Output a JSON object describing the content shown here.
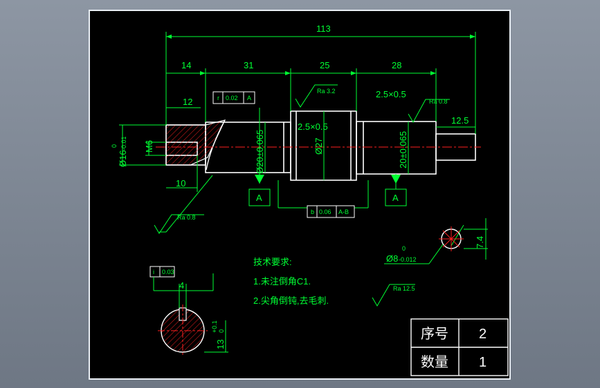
{
  "dimensions": {
    "overall_length": "113",
    "seg_14": "14",
    "seg_31": "31",
    "seg_25": "25",
    "seg_28": "28",
    "thread_len": "12",
    "end_len": "12.5",
    "hole_depth": "10",
    "dia_16": "Ø16",
    "dia_16_upper": "0",
    "dia_16_lower": "-0.01",
    "thread_m6": "M6",
    "dia_20_left": "Ø20±0.065",
    "dia_27": "Ø27",
    "dia_20_right": "20±0.065",
    "chamfer_left": "2.5×0.5",
    "chamfer_right": "2.5×0.5",
    "dia_8": "Ø8",
    "dia_8_upper": "0",
    "dia_8_lower": "-0.012",
    "key_depth": "7.4",
    "section_width": "4",
    "section_depth": "13",
    "section_depth_upper": "+0.1",
    "section_depth_lower": "0"
  },
  "roughness": {
    "ra_32": "Ra 3.2",
    "ra_08_right": "Ra 0.8",
    "ra_08_left": "Ra 0.8",
    "ra_125": "Ra 12.5"
  },
  "tolerance_frames": {
    "runout_top": {
      "symbol": "r",
      "value": "0.02",
      "datum": "A"
    },
    "runout_bottom": {
      "symbol": "b",
      "value": "0.06",
      "datum": "A-B"
    },
    "symmetry": {
      "symbol": "i",
      "value": "0.03"
    }
  },
  "datums": {
    "left": "A",
    "right": "A"
  },
  "notes": {
    "title": "技术要求:",
    "line1": "1.未注倒角C1.",
    "line2": "2.尖角倒钝,去毛刺."
  },
  "title_block": {
    "serial_label": "序号",
    "serial_value": "2",
    "qty_label": "数量",
    "qty_value": "1"
  },
  "colors": {
    "background": "#000000",
    "outline": "#ffffff",
    "dimension": "#00ff33",
    "centerline": "#ff2020",
    "hatch": "#ff2020",
    "leader": "#00ff33",
    "frame": "#e9eef4"
  }
}
